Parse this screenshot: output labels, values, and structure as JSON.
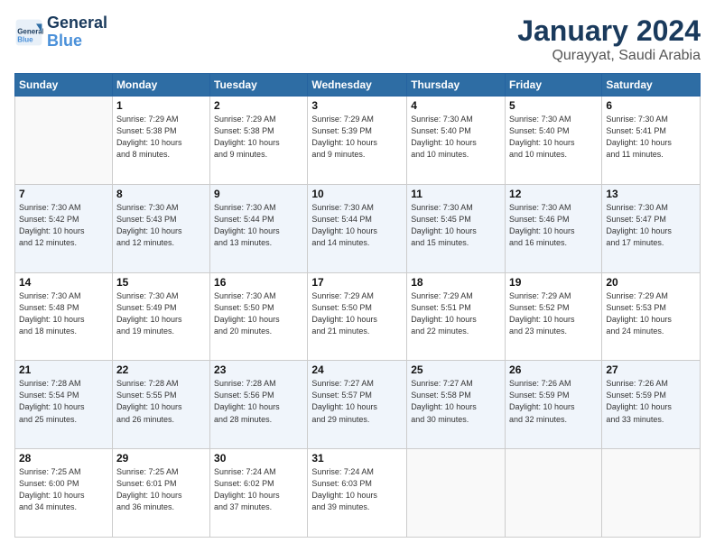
{
  "logo": {
    "line1": "General",
    "line2": "Blue"
  },
  "title": "January 2024",
  "subtitle": "Qurayyat, Saudi Arabia",
  "days_header": [
    "Sunday",
    "Monday",
    "Tuesday",
    "Wednesday",
    "Thursday",
    "Friday",
    "Saturday"
  ],
  "weeks": [
    [
      {
        "day": "",
        "info": ""
      },
      {
        "day": "1",
        "info": "Sunrise: 7:29 AM\nSunset: 5:38 PM\nDaylight: 10 hours\nand 8 minutes."
      },
      {
        "day": "2",
        "info": "Sunrise: 7:29 AM\nSunset: 5:38 PM\nDaylight: 10 hours\nand 9 minutes."
      },
      {
        "day": "3",
        "info": "Sunrise: 7:29 AM\nSunset: 5:39 PM\nDaylight: 10 hours\nand 9 minutes."
      },
      {
        "day": "4",
        "info": "Sunrise: 7:30 AM\nSunset: 5:40 PM\nDaylight: 10 hours\nand 10 minutes."
      },
      {
        "day": "5",
        "info": "Sunrise: 7:30 AM\nSunset: 5:40 PM\nDaylight: 10 hours\nand 10 minutes."
      },
      {
        "day": "6",
        "info": "Sunrise: 7:30 AM\nSunset: 5:41 PM\nDaylight: 10 hours\nand 11 minutes."
      }
    ],
    [
      {
        "day": "7",
        "info": "Sunrise: 7:30 AM\nSunset: 5:42 PM\nDaylight: 10 hours\nand 12 minutes."
      },
      {
        "day": "8",
        "info": "Sunrise: 7:30 AM\nSunset: 5:43 PM\nDaylight: 10 hours\nand 12 minutes."
      },
      {
        "day": "9",
        "info": "Sunrise: 7:30 AM\nSunset: 5:44 PM\nDaylight: 10 hours\nand 13 minutes."
      },
      {
        "day": "10",
        "info": "Sunrise: 7:30 AM\nSunset: 5:44 PM\nDaylight: 10 hours\nand 14 minutes."
      },
      {
        "day": "11",
        "info": "Sunrise: 7:30 AM\nSunset: 5:45 PM\nDaylight: 10 hours\nand 15 minutes."
      },
      {
        "day": "12",
        "info": "Sunrise: 7:30 AM\nSunset: 5:46 PM\nDaylight: 10 hours\nand 16 minutes."
      },
      {
        "day": "13",
        "info": "Sunrise: 7:30 AM\nSunset: 5:47 PM\nDaylight: 10 hours\nand 17 minutes."
      }
    ],
    [
      {
        "day": "14",
        "info": "Sunrise: 7:30 AM\nSunset: 5:48 PM\nDaylight: 10 hours\nand 18 minutes."
      },
      {
        "day": "15",
        "info": "Sunrise: 7:30 AM\nSunset: 5:49 PM\nDaylight: 10 hours\nand 19 minutes."
      },
      {
        "day": "16",
        "info": "Sunrise: 7:30 AM\nSunset: 5:50 PM\nDaylight: 10 hours\nand 20 minutes."
      },
      {
        "day": "17",
        "info": "Sunrise: 7:29 AM\nSunset: 5:50 PM\nDaylight: 10 hours\nand 21 minutes."
      },
      {
        "day": "18",
        "info": "Sunrise: 7:29 AM\nSunset: 5:51 PM\nDaylight: 10 hours\nand 22 minutes."
      },
      {
        "day": "19",
        "info": "Sunrise: 7:29 AM\nSunset: 5:52 PM\nDaylight: 10 hours\nand 23 minutes."
      },
      {
        "day": "20",
        "info": "Sunrise: 7:29 AM\nSunset: 5:53 PM\nDaylight: 10 hours\nand 24 minutes."
      }
    ],
    [
      {
        "day": "21",
        "info": "Sunrise: 7:28 AM\nSunset: 5:54 PM\nDaylight: 10 hours\nand 25 minutes."
      },
      {
        "day": "22",
        "info": "Sunrise: 7:28 AM\nSunset: 5:55 PM\nDaylight: 10 hours\nand 26 minutes."
      },
      {
        "day": "23",
        "info": "Sunrise: 7:28 AM\nSunset: 5:56 PM\nDaylight: 10 hours\nand 28 minutes."
      },
      {
        "day": "24",
        "info": "Sunrise: 7:27 AM\nSunset: 5:57 PM\nDaylight: 10 hours\nand 29 minutes."
      },
      {
        "day": "25",
        "info": "Sunrise: 7:27 AM\nSunset: 5:58 PM\nDaylight: 10 hours\nand 30 minutes."
      },
      {
        "day": "26",
        "info": "Sunrise: 7:26 AM\nSunset: 5:59 PM\nDaylight: 10 hours\nand 32 minutes."
      },
      {
        "day": "27",
        "info": "Sunrise: 7:26 AM\nSunset: 5:59 PM\nDaylight: 10 hours\nand 33 minutes."
      }
    ],
    [
      {
        "day": "28",
        "info": "Sunrise: 7:25 AM\nSunset: 6:00 PM\nDaylight: 10 hours\nand 34 minutes."
      },
      {
        "day": "29",
        "info": "Sunrise: 7:25 AM\nSunset: 6:01 PM\nDaylight: 10 hours\nand 36 minutes."
      },
      {
        "day": "30",
        "info": "Sunrise: 7:24 AM\nSunset: 6:02 PM\nDaylight: 10 hours\nand 37 minutes."
      },
      {
        "day": "31",
        "info": "Sunrise: 7:24 AM\nSunset: 6:03 PM\nDaylight: 10 hours\nand 39 minutes."
      },
      {
        "day": "",
        "info": ""
      },
      {
        "day": "",
        "info": ""
      },
      {
        "day": "",
        "info": ""
      }
    ]
  ]
}
